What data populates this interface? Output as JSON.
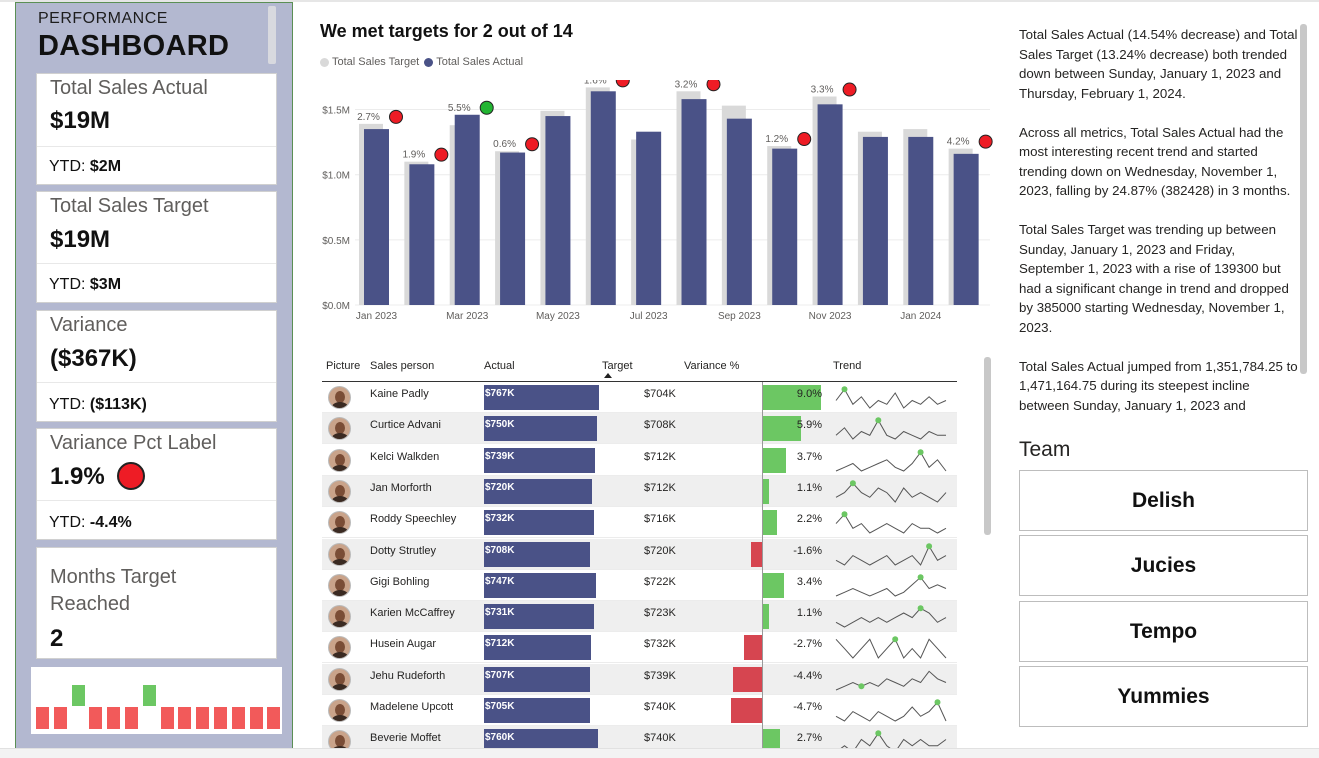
{
  "sidebar": {
    "title_line1": "PERFORMANCE",
    "title_line2": "DASHBOARD",
    "kpis": [
      {
        "label": "Total Sales Actual",
        "value": "$19M",
        "ytd_label": "YTD:",
        "ytd_value": "$2M"
      },
      {
        "label": "Total Sales Target",
        "value": "$19M",
        "ytd_label": "YTD:",
        "ytd_value": "$3M"
      },
      {
        "label": "Variance",
        "value": "($367K)",
        "ytd_label": "YTD:",
        "ytd_value": "($113K)"
      },
      {
        "label": "Variance Pct Label",
        "value": "1.9%",
        "ytd_label": "YTD:",
        "ytd_value": "-4.4%",
        "status": "red"
      }
    ],
    "months_card": {
      "label": "Months Target Reached",
      "value": "2"
    },
    "mini_chart": {
      "months_reached": [
        false,
        false,
        true,
        false,
        false,
        false,
        true,
        false,
        false,
        false,
        false,
        false,
        false,
        false
      ],
      "colors": {
        "reached": "#6cc763",
        "missed": "#f25a5a"
      }
    }
  },
  "chart": {
    "title": "We met targets for 2 out of 14",
    "legend": [
      {
        "name": "Total Sales Target",
        "color": "#d9d9d9"
      },
      {
        "name": "Total Sales Actual",
        "color": "#4a5287"
      }
    ]
  },
  "chart_data": {
    "type": "bar",
    "categories": [
      "Jan 2023",
      "Feb 2023",
      "Mar 2023",
      "Apr 2023",
      "May 2023",
      "Jun 2023",
      "Jul 2023",
      "Aug 2023",
      "Sep 2023",
      "Oct 2023",
      "Nov 2023",
      "Dec 2023",
      "Jan 2024",
      "Feb 2024"
    ],
    "x_tick_labels": [
      "Jan 2023",
      "Mar 2023",
      "May 2023",
      "Jul 2023",
      "Sep 2023",
      "Nov 2023",
      "Jan 2024"
    ],
    "y_tick_labels": [
      "$0.0M",
      "$0.5M",
      "$1.0M",
      "$1.5M"
    ],
    "ylim": [
      0,
      1.65
    ],
    "series": [
      {
        "name": "Total Sales Target",
        "color": "#d9d9d9",
        "values": [
          1.39,
          1.1,
          1.38,
          1.18,
          1.49,
          1.67,
          1.27,
          1.64,
          1.53,
          1.22,
          1.6,
          1.33,
          1.35,
          1.2
        ]
      },
      {
        "name": "Total Sales Actual",
        "color": "#4a5287",
        "values": [
          1.35,
          1.08,
          1.46,
          1.17,
          1.45,
          1.64,
          1.33,
          1.58,
          1.43,
          1.2,
          1.54,
          1.29,
          1.29,
          1.16
        ]
      }
    ],
    "data_labels": [
      "2.7%",
      "1.9%",
      "5.5%",
      "0.6%",
      "",
      "1.6%",
      "",
      "3.2%",
      "",
      "1.2%",
      "3.3%",
      "",
      "",
      "4.2%"
    ],
    "markers": [
      "red",
      "red",
      "green",
      "red",
      "",
      "red",
      "",
      "red",
      "",
      "red",
      "red",
      "",
      "",
      "red"
    ]
  },
  "table": {
    "headers": [
      "Picture",
      "Sales person",
      "Actual",
      "Target",
      "Variance %",
      "Trend"
    ],
    "rows": [
      {
        "name": "Kaine Padly",
        "actual": "$767K",
        "actual_v": 767,
        "target": "$704K",
        "variance": "9.0%",
        "var_v": 9.0,
        "trend": [
          4,
          7,
          3,
          5,
          2,
          4,
          3,
          6,
          2,
          4,
          3,
          5,
          3,
          4
        ],
        "peak": 1
      },
      {
        "name": "Curtice Advani",
        "actual": "$750K",
        "actual_v": 750,
        "target": "$708K",
        "variance": "5.9%",
        "var_v": 5.9,
        "trend": [
          3,
          5,
          2,
          4,
          3,
          7,
          3,
          2,
          4,
          3,
          2,
          4,
          3,
          3
        ],
        "peak": 5
      },
      {
        "name": "Kelci Walkden",
        "actual": "$739K",
        "actual_v": 739,
        "target": "$712K",
        "variance": "3.7%",
        "var_v": 3.7,
        "trend": [
          2,
          3,
          4,
          2,
          3,
          4,
          5,
          3,
          2,
          4,
          7,
          3,
          5,
          2
        ],
        "peak": 10
      },
      {
        "name": "Jan Morforth",
        "actual": "$720K",
        "actual_v": 720,
        "target": "$712K",
        "variance": "1.1%",
        "var_v": 1.1,
        "trend": [
          3,
          4,
          6,
          4,
          3,
          5,
          4,
          2,
          5,
          3,
          4,
          3,
          2,
          4
        ],
        "peak": 2
      },
      {
        "name": "Roddy Speechley",
        "actual": "$732K",
        "actual_v": 732,
        "target": "$716K",
        "variance": "2.2%",
        "var_v": 2.2,
        "trend": [
          4,
          6,
          3,
          4,
          2,
          3,
          4,
          3,
          2,
          4,
          3,
          3,
          2,
          3
        ],
        "peak": 1
      },
      {
        "name": "Dotty Strutley",
        "actual": "$708K",
        "actual_v": 708,
        "target": "$720K",
        "variance": "-1.6%",
        "var_v": -1.6,
        "trend": [
          3,
          2,
          4,
          3,
          2,
          3,
          4,
          2,
          3,
          4,
          2,
          6,
          3,
          4
        ],
        "peak": 11
      },
      {
        "name": "Gigi Bohling",
        "actual": "$747K",
        "actual_v": 747,
        "target": "$722K",
        "variance": "3.4%",
        "var_v": 3.4,
        "trend": [
          2,
          3,
          4,
          3,
          2,
          3,
          4,
          2,
          3,
          5,
          7,
          4,
          5,
          4
        ],
        "peak": 10
      },
      {
        "name": "Karien McCaffrey",
        "actual": "$731K",
        "actual_v": 731,
        "target": "$723K",
        "variance": "1.1%",
        "var_v": 1.1,
        "trend": [
          3,
          2,
          3,
          4,
          3,
          4,
          3,
          4,
          5,
          4,
          6,
          5,
          3,
          4
        ],
        "peak": 10
      },
      {
        "name": "Husein Augar",
        "actual": "$712K",
        "actual_v": 712,
        "target": "$732K",
        "variance": "-2.7%",
        "var_v": -2.7,
        "trend": [
          5,
          4,
          3,
          4,
          5,
          3,
          4,
          5,
          3,
          4,
          3,
          5,
          4,
          3
        ],
        "peak": 7
      },
      {
        "name": "Jehu Rudeforth",
        "actual": "$707K",
        "actual_v": 707,
        "target": "$739K",
        "variance": "-4.4%",
        "var_v": -4.4,
        "trend": [
          2,
          3,
          4,
          3,
          4,
          3,
          5,
          4,
          3,
          5,
          4,
          7,
          5,
          4
        ],
        "peak": 3
      },
      {
        "name": "Madelene Upcott",
        "actual": "$705K",
        "actual_v": 705,
        "target": "$740K",
        "variance": "-4.7%",
        "var_v": -4.7,
        "trend": [
          3,
          2,
          4,
          3,
          2,
          4,
          3,
          2,
          3,
          5,
          3,
          4,
          6,
          2
        ],
        "peak": 12
      },
      {
        "name": "Beverie Moffet",
        "actual": "$760K",
        "actual_v": 760,
        "target": "$740K",
        "variance": "2.7%",
        "var_v": 2.7,
        "trend": [
          2,
          3,
          2,
          4,
          3,
          5,
          3,
          2,
          4,
          3,
          4,
          3,
          3,
          4
        ],
        "peak": 5
      }
    ],
    "colors": {
      "positive": "#6cc763",
      "negative": "#d64550",
      "actual_bar": "#4a5287",
      "spark": "#555555",
      "spark_peak": "#6cc763"
    }
  },
  "narrative": {
    "paragraphs": [
      "Total Sales Actual (14.54% decrease) and Total Sales Target (13.24% decrease) both trended down between Sunday, January 1, 2023 and Thursday, February 1, 2024.",
      "Across all metrics, Total Sales Actual had the most interesting recent trend and started trending down on Wednesday, November 1, 2023, falling by 24.87% (382428) in 3 months.",
      "Total Sales Target was trending up between Sunday, January 1, 2023 and Friday, September 1, 2023 with a rise of 139300 but had a significant change in trend and dropped by 385000 starting Wednesday, November 1, 2023.",
      "Total Sales Actual jumped from 1,351,784.25 to 1,471,164.75 during its steepest incline between Sunday, January 1, 2023 and"
    ]
  },
  "team": {
    "title": "Team",
    "buttons": [
      "Delish",
      "Jucies",
      "Tempo",
      "Yummies"
    ]
  }
}
